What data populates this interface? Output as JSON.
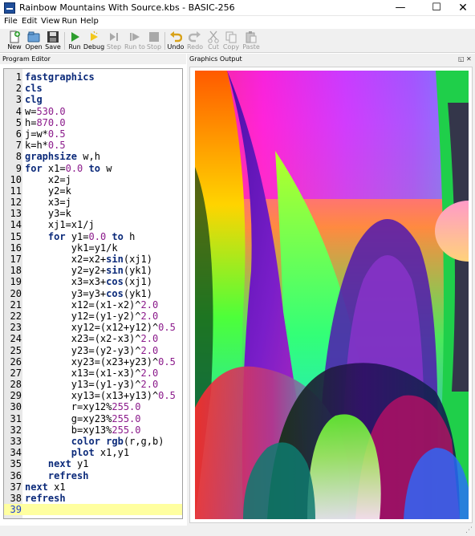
{
  "window": {
    "title": "Rainbow Mountains With Source.kbs - BASIC-256",
    "minimize": "—",
    "maximize": "☐",
    "close": "✕"
  },
  "menu": [
    "File",
    "Edit",
    "View",
    "Run",
    "Help"
  ],
  "toolbar": {
    "new": "New",
    "open": "Open",
    "save": "Save",
    "run": "Run",
    "debug": "Debug",
    "step": "Step",
    "run_to": "Run to",
    "stop": "Stop",
    "undo": "Undo",
    "redo": "Redo",
    "cut": "Cut",
    "copy": "Copy",
    "paste": "Paste"
  },
  "panels": {
    "editor_title": "Program Editor",
    "graphics_title": "Graphics Output",
    "dock_float": "◱",
    "dock_close": "✕"
  },
  "editor": {
    "current_line": 39,
    "lines": [
      [
        [
          "k",
          "fastgraphics"
        ]
      ],
      [
        [
          "k",
          "cls"
        ]
      ],
      [
        [
          "k",
          "clg"
        ]
      ],
      [
        [
          "t",
          "w="
        ],
        [
          "n",
          "530.0"
        ]
      ],
      [
        [
          "t",
          "h="
        ],
        [
          "n",
          "870.0"
        ]
      ],
      [
        [
          "t",
          "j=w*"
        ],
        [
          "n",
          "0.5"
        ]
      ],
      [
        [
          "t",
          "k=h*"
        ],
        [
          "n",
          "0.5"
        ]
      ],
      [
        [
          "k",
          "graphsize"
        ],
        [
          "t",
          " w,h"
        ]
      ],
      [
        [
          "k",
          "for"
        ],
        [
          "t",
          " x1="
        ],
        [
          "n",
          "0.0"
        ],
        [
          "t",
          " "
        ],
        [
          "k",
          "to"
        ],
        [
          "t",
          " w"
        ]
      ],
      [
        [
          "t",
          "    x2=j"
        ]
      ],
      [
        [
          "t",
          "    y2=k"
        ]
      ],
      [
        [
          "t",
          "    x3=j"
        ]
      ],
      [
        [
          "t",
          "    y3=k"
        ]
      ],
      [
        [
          "t",
          "    xj1=x1/j"
        ]
      ],
      [
        [
          "t",
          "    "
        ],
        [
          "k",
          "for"
        ],
        [
          "t",
          " y1="
        ],
        [
          "n",
          "0.0"
        ],
        [
          "t",
          " "
        ],
        [
          "k",
          "to"
        ],
        [
          "t",
          " h"
        ]
      ],
      [
        [
          "t",
          "        yk1=y1/k"
        ]
      ],
      [
        [
          "t",
          "        x2=x2+"
        ],
        [
          "k",
          "sin"
        ],
        [
          "t",
          "(xj1)"
        ]
      ],
      [
        [
          "t",
          "        y2=y2+"
        ],
        [
          "k",
          "sin"
        ],
        [
          "t",
          "(yk1)"
        ]
      ],
      [
        [
          "t",
          "        x3=x3+"
        ],
        [
          "k",
          "cos"
        ],
        [
          "t",
          "(xj1)"
        ]
      ],
      [
        [
          "t",
          "        y3=y3+"
        ],
        [
          "k",
          "cos"
        ],
        [
          "t",
          "(yk1)"
        ]
      ],
      [
        [
          "t",
          "        x12=(x1-x2)^"
        ],
        [
          "n",
          "2.0"
        ]
      ],
      [
        [
          "t",
          "        y12=(y1-y2)^"
        ],
        [
          "n",
          "2.0"
        ]
      ],
      [
        [
          "t",
          "        xy12=(x12+y12)^"
        ],
        [
          "n",
          "0.5"
        ]
      ],
      [
        [
          "t",
          "        x23=(x2-x3)^"
        ],
        [
          "n",
          "2.0"
        ]
      ],
      [
        [
          "t",
          "        y23=(y2-y3)^"
        ],
        [
          "n",
          "2.0"
        ]
      ],
      [
        [
          "t",
          "        xy23=(x23+y23)^"
        ],
        [
          "n",
          "0.5"
        ]
      ],
      [
        [
          "t",
          "        x13=(x1-x3)^"
        ],
        [
          "n",
          "2.0"
        ]
      ],
      [
        [
          "t",
          "        y13=(y1-y3)^"
        ],
        [
          "n",
          "2.0"
        ]
      ],
      [
        [
          "t",
          "        xy13=(x13+y13)^"
        ],
        [
          "n",
          "0.5"
        ]
      ],
      [
        [
          "t",
          "        r=xy12%"
        ],
        [
          "n",
          "255.0"
        ]
      ],
      [
        [
          "t",
          "        g=xy23%"
        ],
        [
          "n",
          "255.0"
        ]
      ],
      [
        [
          "t",
          "        b=xy13%"
        ],
        [
          "n",
          "255.0"
        ]
      ],
      [
        [
          "t",
          "        "
        ],
        [
          "k",
          "color"
        ],
        [
          "t",
          " "
        ],
        [
          "k",
          "rgb"
        ],
        [
          "t",
          "(r,g,b)"
        ]
      ],
      [
        [
          "t",
          "        "
        ],
        [
          "k",
          "plot"
        ],
        [
          "t",
          " x1,y1"
        ]
      ],
      [
        [
          "t",
          "    "
        ],
        [
          "k",
          "next"
        ],
        [
          "t",
          " y1"
        ]
      ],
      [
        [
          "t",
          "    "
        ],
        [
          "k",
          "refresh"
        ]
      ],
      [
        [
          "k",
          "next"
        ],
        [
          "t",
          " x1"
        ]
      ],
      [
        [
          "k",
          "refresh"
        ]
      ],
      [
        [
          "t",
          ""
        ]
      ]
    ]
  },
  "colors": {
    "keyword": "#0b2a7a",
    "number": "#8b1a8b",
    "current_line_bg": "#ffffa0",
    "gutter_bg": "#e8e8e8",
    "run_green": "#2e9e2e"
  }
}
